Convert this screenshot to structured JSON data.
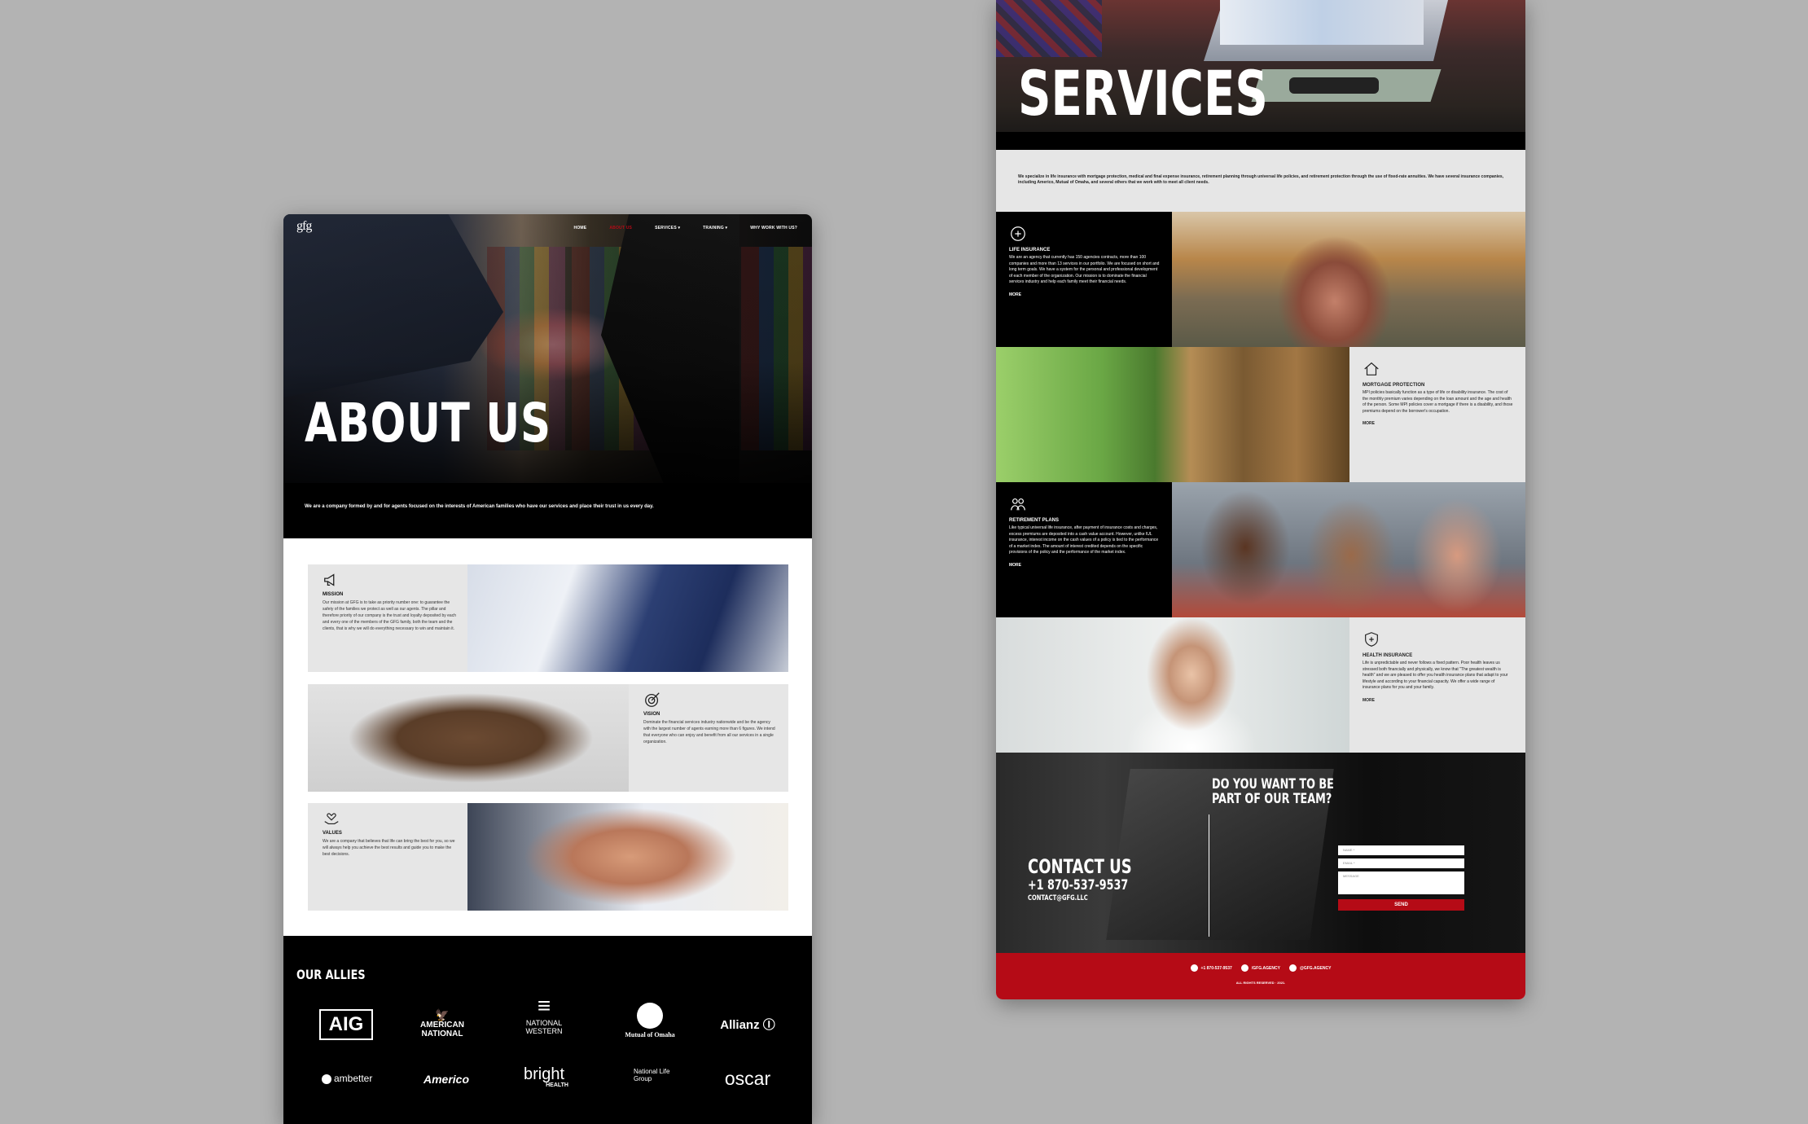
{
  "about_page": {
    "logo": "gfg",
    "nav": [
      "HOME",
      "ABOUT US",
      "SERVICES",
      "TRAINING",
      "WHY WORK WITH US?"
    ],
    "title": "ABOUT US",
    "tagline": "We are a company formed by and for agents focused on the interests of American families who have our services and place their trust in us every day.",
    "mission": {
      "heading": "MISSION",
      "text": "Our mission at GFG is to take as priority number one: to guarantee the safety of the families we protect as well as our agents. The pillar and therefore priority of our company is the trust and loyalty deposited by each and every one of the members of the GFG family, both the team and the clients, that is why we will do everything necessary to win and maintain it."
    },
    "vision": {
      "heading": "VISION",
      "text": "Dominate the financial services industry nationwide and be the agency with the largest number of agents earning more than 6 figures. We intend that everyone who can enjoy and benefit from all our services in a single organization."
    },
    "values": {
      "heading": "VALUES",
      "text": "We are a company that believes that life can bring the best for you, so we will always help you achieve the best results and guide you to make the best decisions."
    },
    "allies_title": "OUR ALLIES",
    "allies": {
      "aig": "AIG",
      "american_national_1": "AMERICAN",
      "american_national_2": "NATIONAL",
      "national_western_1": "NATIONAL",
      "national_western_2": "WESTERN",
      "mutual_omaha": "Mutual of Omaha",
      "allianz": "Allianz",
      "ambetter": "ambetter",
      "americo": "Americo",
      "bright_1": "bright",
      "bright_2": "HEALTH",
      "national_life_1": "National Life",
      "national_life_2": "Group",
      "oscar": "oscar"
    }
  },
  "services_page": {
    "title": "SERVICES",
    "intro": "We specialize in life insurance with mortgage protection, medical and final expense insurance, retirement planning through universal life policies, and retirement protection through the use of fixed-rate annuities. We have several insurance companies, including Americo, Mutual of Omaha, and several others that we work with to meet all client needs.",
    "more_label": "MORE",
    "services": [
      {
        "heading": "LIFE INSURANCE",
        "text": "We are an agency that currently has 150 agencies contracts, more than 100 companies and more than 13 services in our portfolio. We are focused on short and long term goals. We have a system for the personal and professional development of each member of the organization. Our mission is to dominate the financial services industry and help each family meet their financial needs."
      },
      {
        "heading": "MORTGAGE PROTECTION",
        "text": "MPI policies basically function as a type of life or disability insurance. The cost of the monthly premium varies depending on the loan amount and the age and health of the person. Some MPI policies cover a mortgage if there is a disability, and those premiums depend on the borrower's occupation."
      },
      {
        "heading": "RETIREMENT PLANS",
        "text": "Like typical universal life insurance, after payment of insurance costs and charges, excess premiums are deposited into a cash value account. However, unlike IUL insurance, interest income on the cash values of a policy is tied to the performance of a market index. The amount of interest credited depends on the specific provisions of the policy and the performance of the market index."
      },
      {
        "heading": "HEALTH INSURANCE",
        "text": "Life is unpredictable and never follows a fixed pattern. Poor health leaves us stressed both financially and physically, we know that \"The greatest wealth is health\" and we are pleased to offer you health insurance plans that adapt to your lifestyle and according to your financial capacity. We offer a wide range of insurance plans for you and your family."
      }
    ],
    "contact": {
      "question_1": "DO YOU WANT TO BE",
      "question_2": "PART OF OUR TEAM?",
      "title": "CONTACT US",
      "phone": "+1 870-537-9537",
      "email": "CONTACT@GFG.LLC",
      "name_placeholder": "NAME *",
      "email_placeholder": "EMAIL *",
      "message_placeholder": "MESSAGE",
      "send_label": "SEND"
    },
    "footer": {
      "phone": "+1 870-537-9537",
      "facebook": "/GFG.AGENCY",
      "instagram": "@GFG.AGENCY",
      "copyright": "ALL RIGHTS RESERVED · 2021."
    }
  },
  "colors": {
    "background": "#b3b3b3",
    "brand_red": "#b50b16",
    "panel_gray": "#e6e6e6",
    "black": "#000000"
  }
}
